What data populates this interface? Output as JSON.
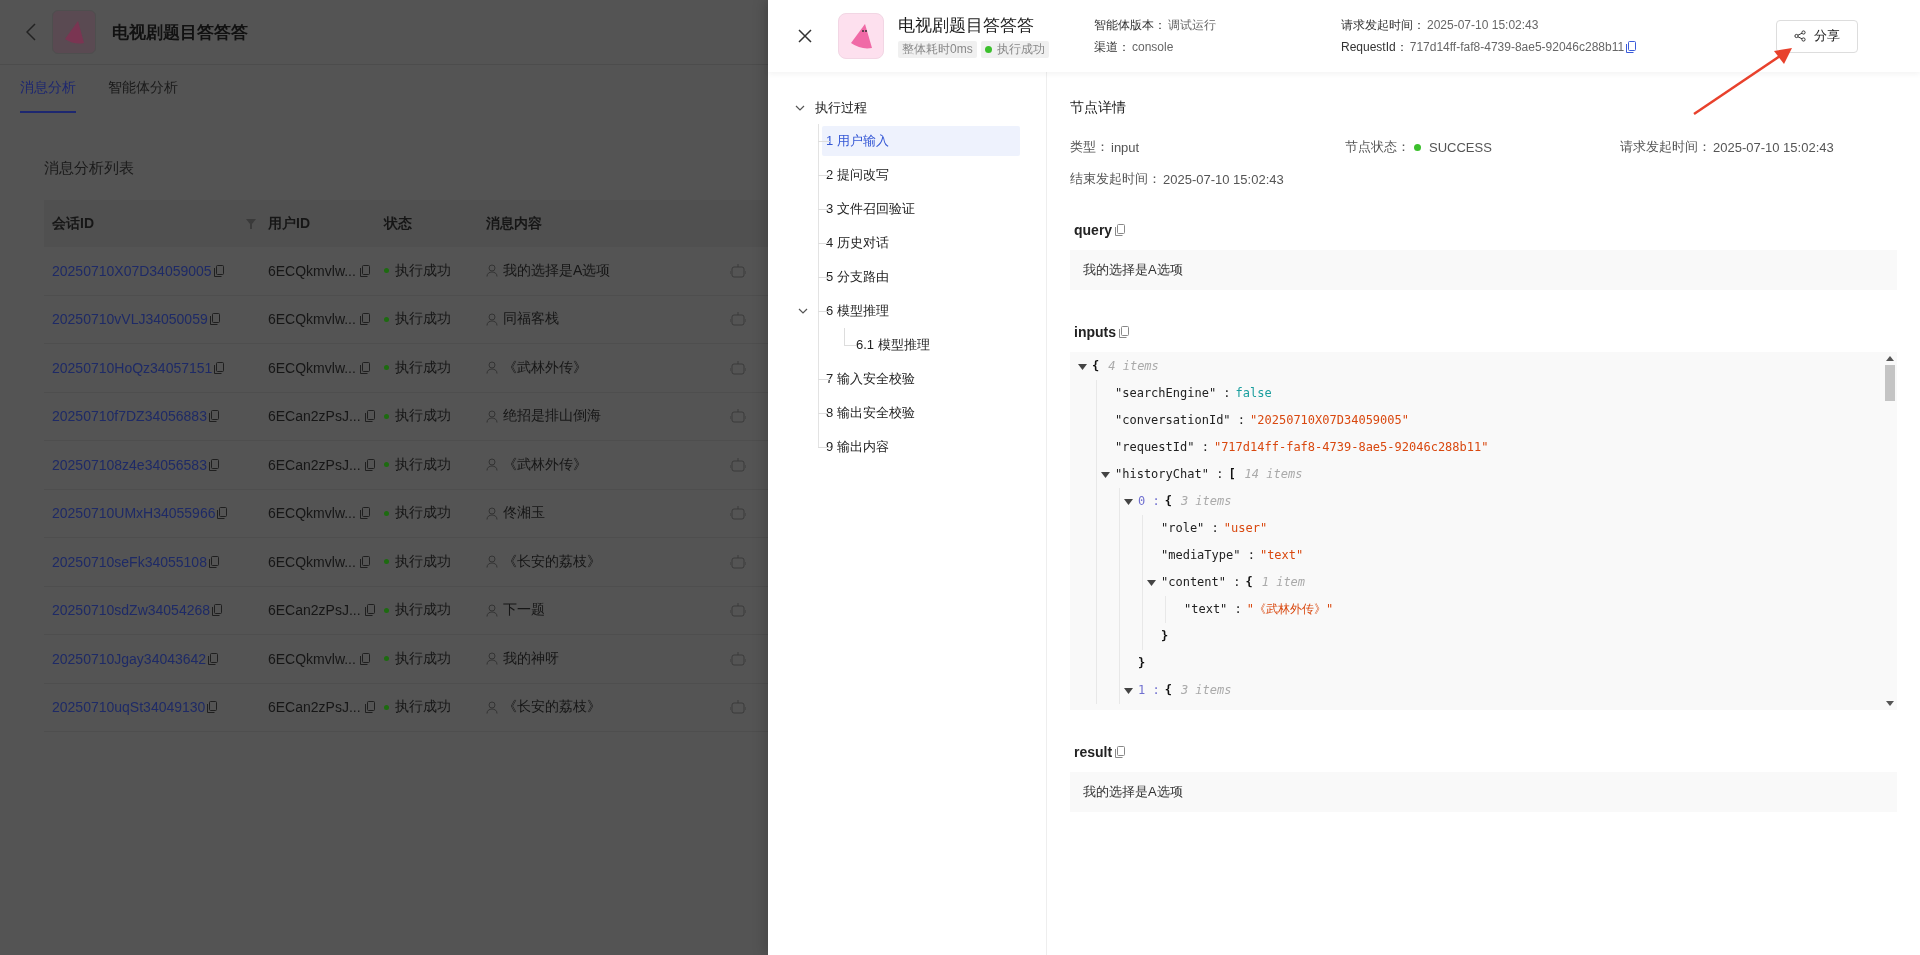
{
  "app": {
    "title": "电视剧题目答答答"
  },
  "tabs": [
    {
      "label": "消息分析",
      "selected": true
    },
    {
      "label": "智能体分析",
      "selected": false
    }
  ],
  "list_title": "消息分析列表",
  "table": {
    "columns": [
      "会话ID",
      "用户ID",
      "状态",
      "消息内容"
    ],
    "rows": [
      {
        "session_id": "20250710X07D34059005",
        "user_id": "6ECQkmvlw...",
        "status": "执行成功",
        "message": "我的选择是A选项"
      },
      {
        "session_id": "20250710vVLJ34050059",
        "user_id": "6ECQkmvlw...",
        "status": "执行成功",
        "message": "同福客栈"
      },
      {
        "session_id": "20250710HoQz34057151",
        "user_id": "6ECQkmvlw...",
        "status": "执行成功",
        "message": "《武林外传》"
      },
      {
        "session_id": "20250710f7DZ34056883",
        "user_id": "6ECan2zPsJ...",
        "status": "执行成功",
        "message": "绝招是排山倒海"
      },
      {
        "session_id": "202507108z4e34056583",
        "user_id": "6ECan2zPsJ...",
        "status": "执行成功",
        "message": "《武林外传》"
      },
      {
        "session_id": "20250710UMxH34055966",
        "user_id": "6ECQkmvlw...",
        "status": "执行成功",
        "message": "佟湘玉"
      },
      {
        "session_id": "20250710seFk34055108",
        "user_id": "6ECQkmvlw...",
        "status": "执行成功",
        "message": "《长安的荔枝》"
      },
      {
        "session_id": "20250710sdZw34054268",
        "user_id": "6ECan2zPsJ...",
        "status": "执行成功",
        "message": "下一题"
      },
      {
        "session_id": "20250710Jgay34043642",
        "user_id": "6ECQkmvlw...",
        "status": "执行成功",
        "message": "我的神呀"
      },
      {
        "session_id": "20250710uqSt34049130",
        "user_id": "6ECan2zPsJ...",
        "status": "执行成功",
        "message": "《长安的荔枝》"
      }
    ]
  },
  "drawer": {
    "title": "电视剧题目答答答",
    "duration": "整体耗时0ms",
    "status": "执行成功",
    "meta": [
      {
        "label": "智能体版本：",
        "value": "调试运行"
      },
      {
        "label": "渠道：",
        "value": "console"
      },
      {
        "label": "请求发起时间：",
        "value": "2025-07-10 15:02:43"
      },
      {
        "label": "RequestId：",
        "value": "717d14ff-faf8-4739-8ae5-92046c288b11",
        "copy": true
      }
    ],
    "share": "分享"
  },
  "tree": {
    "label": "执行过程",
    "expanded": true,
    "children": [
      {
        "label": "1 用户输入",
        "selected": true
      },
      {
        "label": "2 提问改写",
        "selected": false
      },
      {
        "label": "3 文件召回验证",
        "selected": false
      },
      {
        "label": "4 历史对话",
        "selected": false
      },
      {
        "label": "5 分支路由",
        "selected": false
      },
      {
        "label": "6 模型推理",
        "selected": false,
        "expanded": true,
        "children": [
          {
            "label": "6.1 模型推理",
            "selected": false
          }
        ]
      },
      {
        "label": "7 输入安全校验",
        "selected": false
      },
      {
        "label": "8 输出安全校验",
        "selected": false
      },
      {
        "label": "9 输出内容",
        "selected": false
      }
    ]
  },
  "node_detail": {
    "title": "节点详情",
    "fields": [
      {
        "label": "类型：",
        "value": "input"
      },
      {
        "label": "节点状态：",
        "value": "SUCCESS",
        "dot": true
      },
      {
        "label": "请求发起时间：",
        "value": "2025-07-10 15:02:43"
      },
      {
        "label": "结束发起时间：",
        "value": "2025-07-10 15:02:43"
      }
    ],
    "sections": [
      {
        "kind": "text",
        "title": "query",
        "text": "我的选择是A选项"
      },
      {
        "kind": "json",
        "title": "inputs",
        "root": {
          "bracket": "{",
          "count": "4 items",
          "expanded": true,
          "children": [
            {
              "key": "\"searchEngine\" :",
              "value": "false",
              "kind": "boolean"
            },
            {
              "key": "\"conversationId\" :",
              "value": "\"20250710X07D34059005\"",
              "kind": "string"
            },
            {
              "key": "\"requestId\" :",
              "value": "\"717d14ff-faf8-4739-8ae5-92046c288b11\"",
              "kind": "string"
            },
            {
              "key": "\"historyChat\" :",
              "bracket": "[",
              "count": "14 items",
              "expanded": true,
              "children": [
                {
                  "key": "0 :",
                  "indexed": true,
                  "bracket": "{",
                  "count": "3 items",
                  "expanded": true,
                  "close": "}",
                  "children": [
                    {
                      "key": "\"role\" :",
                      "value": "\"user\"",
                      "kind": "string"
                    },
                    {
                      "key": "\"mediaType\" :",
                      "value": "\"text\"",
                      "kind": "string"
                    },
                    {
                      "key": "\"content\" :",
                      "bracket": "{",
                      "count": "1 item",
                      "expanded": true,
                      "close": "}",
                      "children": [
                        {
                          "key": "\"text\" :",
                          "value": "\"《武林外传》\"",
                          "kind": "string"
                        }
                      ]
                    }
                  ]
                },
                {
                  "key": "1 :",
                  "indexed": true,
                  "bracket": "{",
                  "count": "3 items",
                  "expanded": true
                }
              ]
            }
          ]
        }
      },
      {
        "kind": "text",
        "title": "result",
        "text": "我的选择是A选项"
      }
    ]
  }
}
